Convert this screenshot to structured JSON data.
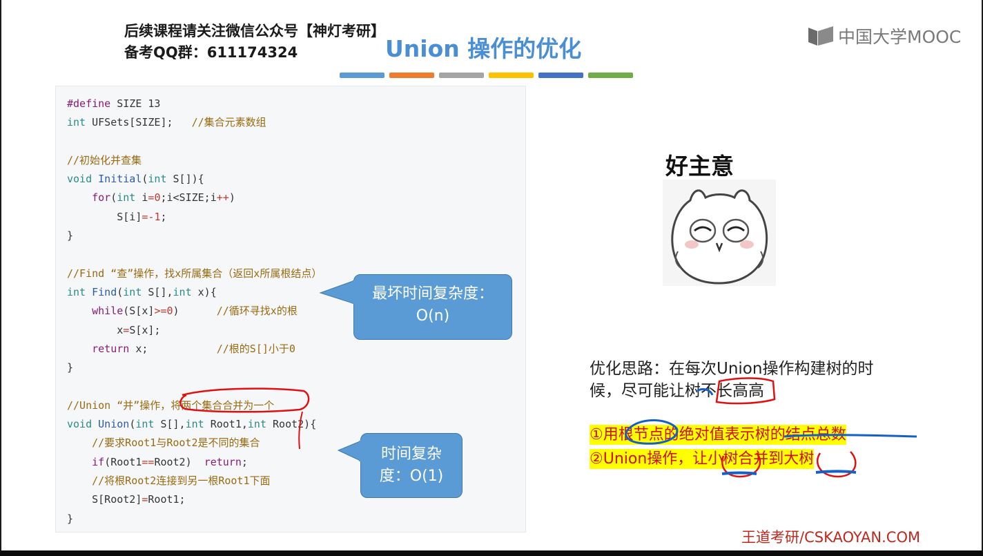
{
  "header": {
    "promo_line1": "后续课程请关注微信公众号【神灯考研】",
    "promo_line2": "备考QQ群：611174324",
    "title": "Union 操作的优化",
    "brand": "中国大学MOOC",
    "brand_icon": "mooc-logo-icon",
    "color_bars": [
      "#5b9bd5",
      "#ed7d31",
      "#a5a5a5",
      "#ffc000",
      "#4472c4",
      "#70ad47"
    ]
  },
  "code": {
    "l1_define": "#define",
    "l1_rest": " SIZE 13",
    "l2_int": "int",
    "l2_rest": " UFSets[SIZE];   ",
    "l2_comment": "//集合元素数组",
    "c_init": "//初始化并查集",
    "l_void": "void",
    "l_initial": "Initial",
    "l_int": "int",
    "l_init_params": " S[]){",
    "l_for": "for",
    "l_int2": "int",
    "l_for_i": " i",
    "l_eq": "=",
    "l_zero": "0",
    "l_cond": ";i<SIZE;i",
    "l_pp": "++",
    "l_paren": ")",
    "l_si": "        S[i]",
    "l_eqm": "=-",
    "l_one": "1",
    "l_semi": ";",
    "l_close": "}",
    "c_find": "//Find “查”操作，找x所属集合（返回x所属根结点）",
    "l_find_int": "int",
    "l_find": "Find",
    "l_find_int2": "int",
    "l_find_mid": " S[],",
    "l_find_int3": "int",
    "l_find_end": " x){",
    "l_while": "while",
    "l_while_a": "(S[x]",
    "l_while_op": ">=",
    "l_while_zero": "0",
    "l_while_b": ")      ",
    "c_loop": "//循环寻找x的根",
    "l_xs_a": "        x",
    "l_xs_op": "=",
    "l_xs_b": "S[x];",
    "l_return": "return",
    "l_return_rest": " x;           ",
    "c_root": "//根的S[]小于0",
    "c_union": "//Union “并”操作，将两个集合合并为一个",
    "l_u_void": "void",
    "l_union": "Union",
    "l_u_int1": "int",
    "l_u_mid1": " S[],",
    "l_u_int2": "int",
    "l_u_mid2": " Root1,",
    "l_u_int3": "int",
    "l_u_end": " Root2){",
    "c_diff": "//要求Root1与Root2是不同的集合",
    "l_if": "if",
    "l_if_a": "(Root1",
    "l_if_op": "==",
    "l_if_b": "Root2)  ",
    "l_if_ret": "return",
    "l_if_semi": ";",
    "c_link": "//将根Root2连接到另一根Root1下面",
    "l_sr_a": "S[Root2]",
    "l_sr_op": "=",
    "l_sr_b": "Root1;"
  },
  "bubbles": {
    "find_line1": "最坏时间复杂度：",
    "find_line2": "O(n)",
    "union_line1": "时间复杂",
    "union_line2": "度：O(1)"
  },
  "meme": {
    "caption": "好主意",
    "icon": "owl-cartoon-icon"
  },
  "idea": {
    "line1": "优化思路：在每次Union操作构建树的时",
    "line2": "候，尽可能让树不长高高",
    "point1": "①用根节点的绝对值表示树的结点总数",
    "point2": "②Union操作，让小树合并到大树"
  },
  "footer": {
    "watermark": "王道考研/CSKAOYAN.COM"
  }
}
